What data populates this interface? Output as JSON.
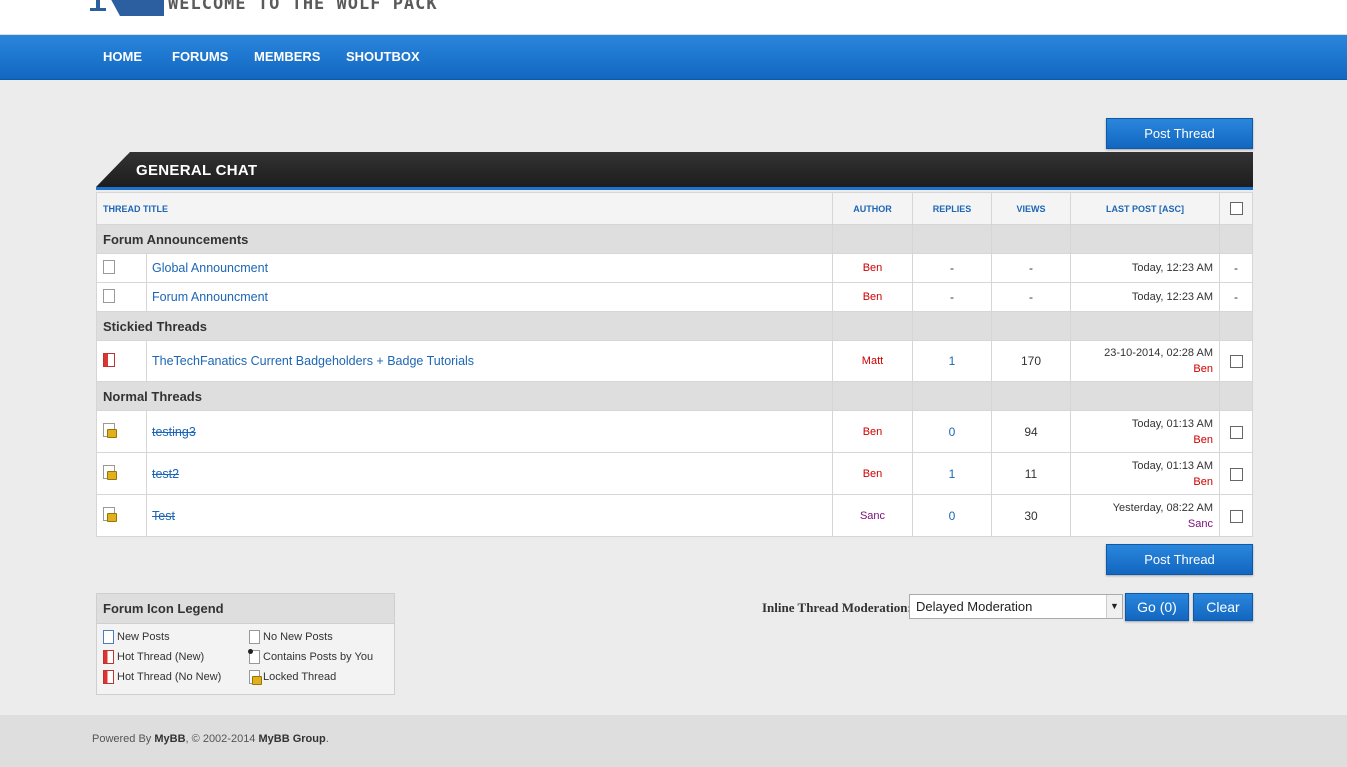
{
  "header": {
    "site_title": "WELCOME TO THE WOLF PACK"
  },
  "nav": {
    "items": [
      "HOME",
      "FORUMS",
      "MEMBERS",
      "SHOUTBOX"
    ]
  },
  "buttons": {
    "post_thread": "Post Thread",
    "go": "Go (0)",
    "clear": "Clear"
  },
  "forum": {
    "title": "GENERAL CHAT",
    "columns": {
      "thread_title": "THREAD TITLE",
      "author": "AUTHOR",
      "replies": "REPLIES",
      "views": "VIEWS",
      "last_post": "LAST POST",
      "asc": "ASC"
    },
    "sections": {
      "announcements": "Forum Announcements",
      "stickied": "Stickied Threads",
      "normal": "Normal Threads"
    },
    "announcements": [
      {
        "title": "Global Announcment",
        "author": "Ben",
        "replies": "-",
        "views": "-",
        "last_post": "Today, 12:23 AM",
        "mod": "-"
      },
      {
        "title": "Forum Announcment",
        "author": "Ben",
        "replies": "-",
        "views": "-",
        "last_post": "Today, 12:23 AM",
        "mod": "-"
      }
    ],
    "stickied": [
      {
        "title": "TheTechFanatics Current Badgeholders + Badge Tutorials",
        "author": "Matt",
        "replies": "1",
        "views": "170",
        "last_post": "23-10-2014, 02:28 AM",
        "last_by": "Ben"
      }
    ],
    "normal": [
      {
        "title": "testing3",
        "author": "Ben",
        "replies": "0",
        "views": "94",
        "last_post": "Today, 01:13 AM",
        "last_by": "Ben"
      },
      {
        "title": "test2",
        "author": "Ben",
        "replies": "1",
        "views": "11",
        "last_post": "Today, 01:13 AM",
        "last_by": "Ben"
      },
      {
        "title": "Test",
        "author": "Sanc",
        "replies": "0",
        "views": "30",
        "last_post": "Yesterday, 08:22 AM",
        "last_by": "Sanc"
      }
    ]
  },
  "legend": {
    "title": "Forum Icon Legend",
    "new_posts": "New Posts",
    "no_new_posts": "No New Posts",
    "hot_new": "Hot Thread (New)",
    "contains_yours": "Contains Posts by You",
    "hot_no_new": "Hot Thread (No New)",
    "locked": "Locked Thread"
  },
  "moderation": {
    "label": "Inline Thread Moderation:",
    "selected": "Delayed Moderation"
  },
  "footer": {
    "powered_by": "Powered By",
    "mybb": "MyBB",
    "copyright": ", © 2002-2014",
    "group": "MyBB Group",
    "period": "."
  },
  "colors": {
    "nav_blue": "#1e73cf",
    "link_blue": "#1d66b5",
    "author_red": "#cc0000",
    "author_purple": "#7a0d7a"
  }
}
